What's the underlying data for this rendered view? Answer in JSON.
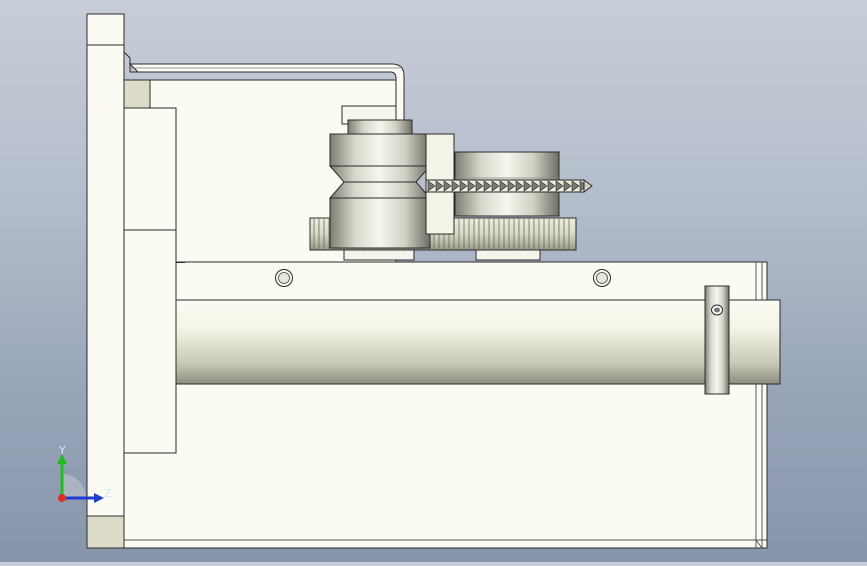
{
  "viewport": {
    "background_top": "#c8ced8",
    "background_bottom": "#8795ab"
  },
  "model": {
    "colors": {
      "body": "#fbfbf2",
      "edge": "#2b2b2b",
      "shadow": "#d8d8c8",
      "metal_light": "#f4f4ee",
      "metal_dark": "#7a7a70"
    }
  },
  "triad": {
    "y_label": "Y",
    "z_label": "Z",
    "x_color": "#e03020",
    "y_color": "#22bb22",
    "z_color": "#1f3fd0"
  }
}
